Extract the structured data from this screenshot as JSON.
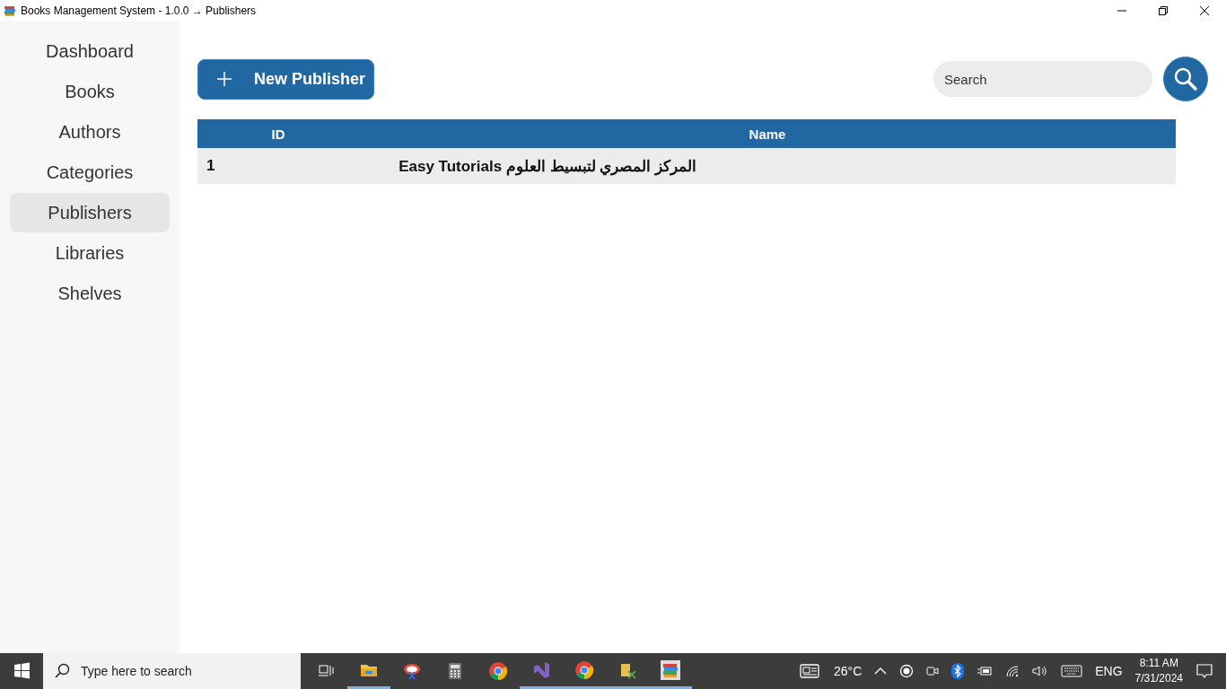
{
  "window": {
    "title": "Books Management System - 1.0.0 → Publishers"
  },
  "sidebar": {
    "items": [
      {
        "label": "Dashboard",
        "selected": false
      },
      {
        "label": "Books",
        "selected": false
      },
      {
        "label": "Authors",
        "selected": false
      },
      {
        "label": "Categories",
        "selected": false
      },
      {
        "label": "Publishers",
        "selected": true
      },
      {
        "label": "Libraries",
        "selected": false
      },
      {
        "label": "Shelves",
        "selected": false
      }
    ]
  },
  "toolbar": {
    "new_button": "New Publisher",
    "search": {
      "placeholder": "Search"
    }
  },
  "table": {
    "columns": [
      "ID",
      "Name"
    ],
    "rows": [
      [
        "1",
        "المركز المصري لتبسيط العلوم Easy Tutorials"
      ]
    ]
  },
  "taskbar": {
    "search": {
      "placeholder": "Type here to search"
    },
    "apps": [
      {
        "kind": "taskview",
        "active": false
      },
      {
        "kind": "folder",
        "active": true
      },
      {
        "kind": "snip",
        "active": false
      },
      {
        "kind": "calc",
        "active": false
      },
      {
        "kind": "chrome",
        "active": false
      },
      {
        "kind": "vs",
        "active": true
      },
      {
        "kind": "chrome",
        "active": true
      },
      {
        "kind": "tool",
        "active": true
      },
      {
        "kind": "books",
        "active": true
      }
    ],
    "weather": "26°C",
    "language": "ENG",
    "time": "8:11 AM",
    "date": "7/31/2024"
  }
}
